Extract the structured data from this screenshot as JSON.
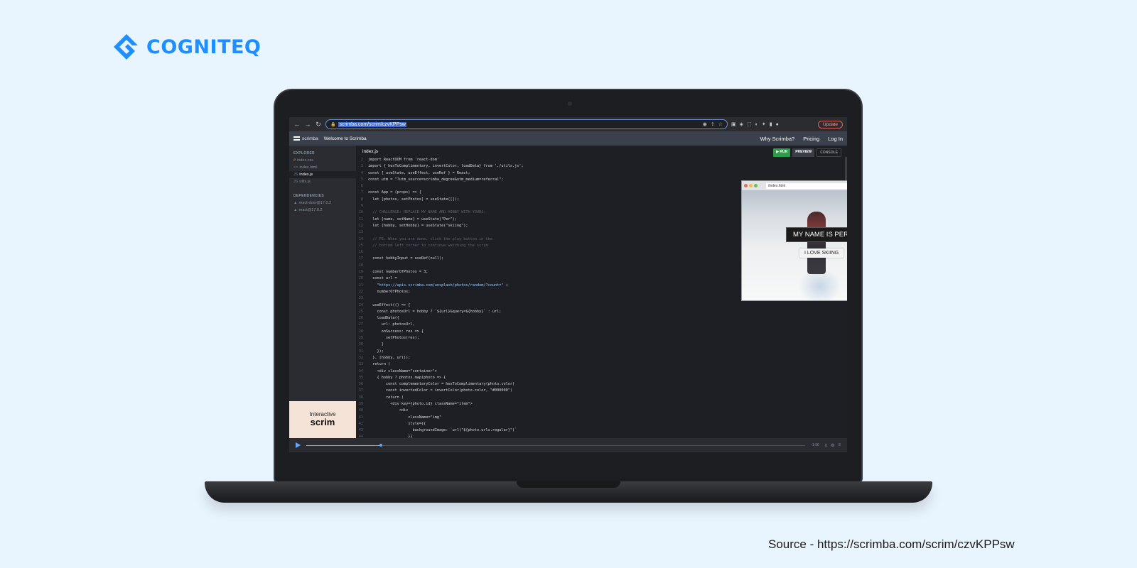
{
  "brand": {
    "name": "COGNITEQ",
    "color": "#1f8fff"
  },
  "source_caption": "Source - https://scrimba.com/scrim/czvKPPsw",
  "browser": {
    "back_icon": "←",
    "forward_icon": "→",
    "reload_icon": "↻",
    "url": "scrimba.com/scrim/czvKPPsw",
    "update_label": "Update"
  },
  "scrimba_bar": {
    "logo_text": "scrimba",
    "title": "Welcome to Scrimba",
    "links": [
      "Why Scrimba?",
      "Pricing",
      "Log In"
    ]
  },
  "sidebar": {
    "explorer_heading": "EXPLORER",
    "files": [
      {
        "icon": "#",
        "name": "index.css",
        "active": false
      },
      {
        "icon": "<>",
        "name": "index.html",
        "active": false
      },
      {
        "icon": "JS",
        "name": "index.js",
        "active": true
      },
      {
        "icon": "JS",
        "name": "utils.js",
        "active": false
      }
    ],
    "dependencies_heading": "DEPENDENCIES",
    "dependencies": [
      "react-dom@17.0.2",
      "react@17.0.2"
    ],
    "promo_line1": "Interactive",
    "promo_line2": "scrim"
  },
  "editor": {
    "tab": "index.js",
    "run_label": "▶ RUN",
    "preview_label": "PREVIEW",
    "console_label": "CONSOLE",
    "lines": [
      {
        "n": "2",
        "t": "import ReactDOM from 'react-dom'",
        "c": ""
      },
      {
        "n": "3",
        "t": "import { hexToComplimentary, invertColor, loadData} from './utils.js';",
        "c": ""
      },
      {
        "n": "4",
        "t": "const { useState, useEffect, useRef } = React;",
        "c": ""
      },
      {
        "n": "5",
        "t": "const utm = \"?utm_source=scrimba_degree&utm_medium=referral\";",
        "c": ""
      },
      {
        "n": "6",
        "t": "",
        "c": ""
      },
      {
        "n": "7",
        "t": "const App = (props) => {",
        "c": ""
      },
      {
        "n": "8",
        "t": "  let [photos, setPhotos] = useState([]);",
        "c": ""
      },
      {
        "n": "9",
        "t": "",
        "c": ""
      },
      {
        "n": "10",
        "t": "  // CHALLENGE: REPLACE MY NAME AND HOBBY WITH YOURS:",
        "c": "cmt"
      },
      {
        "n": "11",
        "t": "  let [name, setName] = useState(\"Per\");",
        "c": ""
      },
      {
        "n": "12",
        "t": "  let [hobby, setHobby] = useState(\"skiing\");",
        "c": ""
      },
      {
        "n": "13",
        "t": "",
        "c": ""
      },
      {
        "n": "14",
        "t": "  // PS: When you are done, click the play button in the",
        "c": "cmt"
      },
      {
        "n": "15",
        "t": "  // bottom left corner to continue watching the scrim",
        "c": "cmt"
      },
      {
        "n": "16",
        "t": "",
        "c": ""
      },
      {
        "n": "17",
        "t": "  const hobbyInput = useRef(null);",
        "c": ""
      },
      {
        "n": "18",
        "t": "",
        "c": ""
      },
      {
        "n": "19",
        "t": "  const numberOfPhotos = 3;",
        "c": ""
      },
      {
        "n": "20",
        "t": "  const url =",
        "c": ""
      },
      {
        "n": "21",
        "t": "    \"https://apis.scrimba.com/unsplash/photos/random/?count=\" +",
        "c": "str"
      },
      {
        "n": "22",
        "t": "    numberOfPhotos;",
        "c": ""
      },
      {
        "n": "23",
        "t": "",
        "c": ""
      },
      {
        "n": "24",
        "t": "  useEffect(() => {",
        "c": ""
      },
      {
        "n": "25",
        "t": "    const photosUrl = hobby ? `${url}&query=${hobby}` : url;",
        "c": ""
      },
      {
        "n": "26",
        "t": "    loadData({",
        "c": ""
      },
      {
        "n": "27",
        "t": "      url: photosUrl,",
        "c": ""
      },
      {
        "n": "28",
        "t": "      onSuccess: res => {",
        "c": ""
      },
      {
        "n": "29",
        "t": "        setPhotos(res);",
        "c": ""
      },
      {
        "n": "30",
        "t": "      }",
        "c": ""
      },
      {
        "n": "31",
        "t": "    });",
        "c": ""
      },
      {
        "n": "32",
        "t": "  }, [hobby, url]);",
        "c": ""
      },
      {
        "n": "33",
        "t": "  return (",
        "c": ""
      },
      {
        "n": "34",
        "t": "    <div className=\"container\">",
        "c": ""
      },
      {
        "n": "35",
        "t": "    { hobby ? photos.map(photo => {",
        "c": ""
      },
      {
        "n": "36",
        "t": "        const complementaryColor = hexToComplimentary(photo.color)",
        "c": ""
      },
      {
        "n": "37",
        "t": "        const invertedColor = invertColor(photo.color, \"#000000\")",
        "c": ""
      },
      {
        "n": "38",
        "t": "        return (",
        "c": ""
      },
      {
        "n": "39",
        "t": "          <div key={photo.id} className=\"item\">",
        "c": ""
      },
      {
        "n": "40",
        "t": "              <div",
        "c": ""
      },
      {
        "n": "41",
        "t": "                  className=\"img\"",
        "c": ""
      },
      {
        "n": "42",
        "t": "                  style={{",
        "c": ""
      },
      {
        "n": "43",
        "t": "                    backgroundImage: `url(\"${photo.urls.regular}\")`",
        "c": ""
      },
      {
        "n": "44",
        "t": "                  }}",
        "c": ""
      }
    ]
  },
  "preview": {
    "url": "/index.html",
    "name_text": "MY NAME IS PER",
    "hobby_text": "I LOVE SKIING"
  },
  "player": {
    "progress": 0.15,
    "time": "-1:50"
  }
}
